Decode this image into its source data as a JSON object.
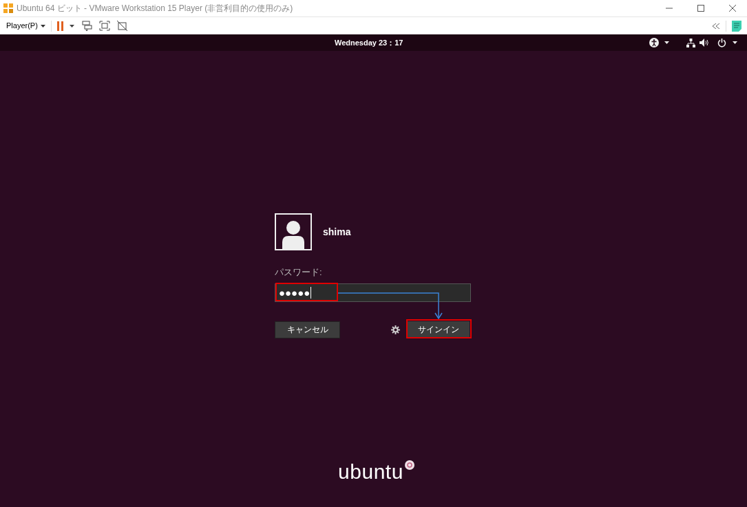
{
  "window": {
    "title": "Ubuntu 64 ビット - VMware Workstation 15 Player (非営利目的の使用のみ)"
  },
  "toolbar": {
    "player_menu": "Player(P)"
  },
  "top_panel": {
    "clock": "Wednesday 23：17"
  },
  "login": {
    "username": "shima",
    "password_label": "パスワード:",
    "password_value": "●●●●●",
    "cancel_button": "キャンセル",
    "sign_in_button": "サインイン"
  },
  "logo": {
    "text": "ubuntu"
  }
}
